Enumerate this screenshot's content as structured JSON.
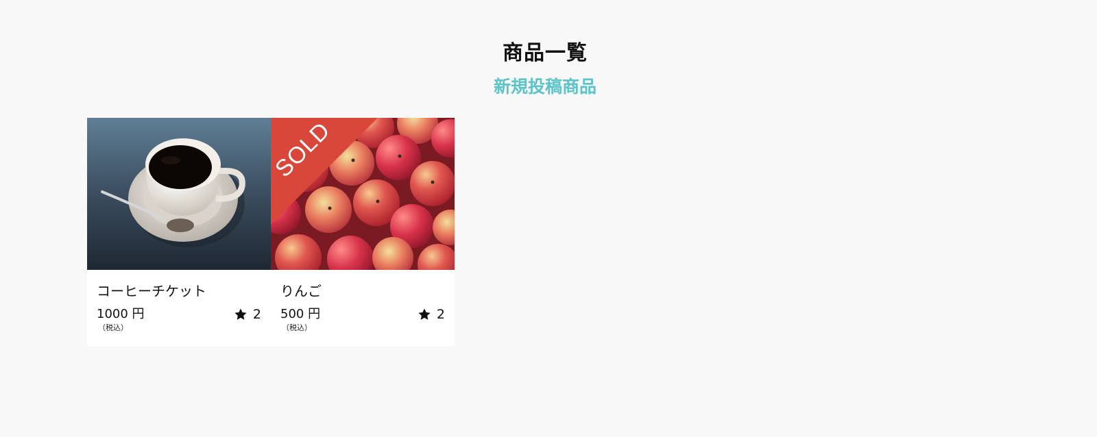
{
  "page": {
    "title": "商品一覧",
    "section_title": "新規投稿商品"
  },
  "items": [
    {
      "name": "コーヒーチケット",
      "price": "1000 円",
      "tax_note": "（税込）",
      "likes": "2",
      "image_icon": "coffee-cup-image",
      "sold": false
    },
    {
      "name": "りんご",
      "price": "500 円",
      "tax_note": "（税込）",
      "likes": "2",
      "image_icon": "apples-image",
      "sold": true,
      "sold_label": "SOLD"
    }
  ],
  "colors": {
    "accent": "#5cc3c8",
    "sold_ribbon": "#d9473a",
    "background": "#f8f8f8"
  }
}
